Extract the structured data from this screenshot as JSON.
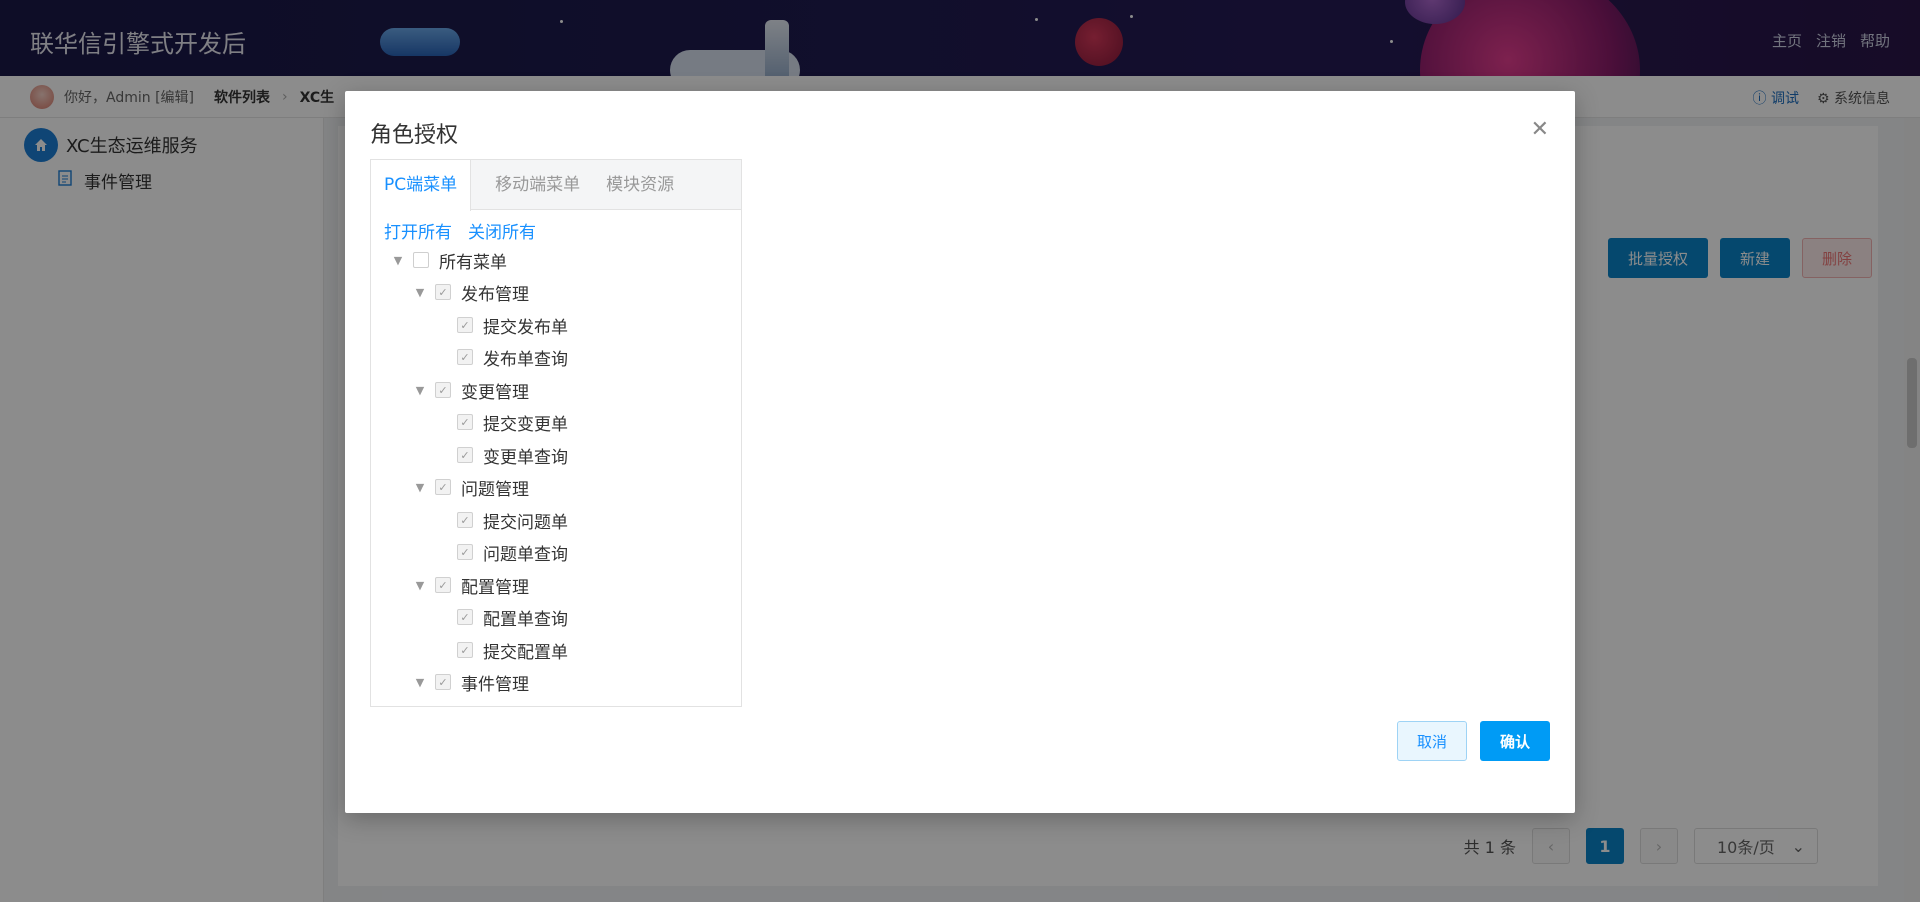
{
  "app": {
    "title": "联华信引擎式开发后",
    "top_links": [
      "主页",
      "注销",
      "帮助"
    ]
  },
  "subbar": {
    "greeting": "你好，Admin [编辑]",
    "breadcrumb": [
      "软件列表",
      "XC生"
    ],
    "right_links": {
      "debug": "调试",
      "sysinfo": "系统信息"
    }
  },
  "sidebar": {
    "root_label": "XC生态运维服务",
    "items": [
      {
        "label": "事件管理"
      }
    ]
  },
  "main": {
    "buttons": {
      "batch": "批量授权",
      "new": "新建",
      "delete": "删除"
    },
    "pagination": {
      "total": "共 1 条",
      "current": "1",
      "page_size": "10条/页"
    }
  },
  "modal": {
    "title": "角色授权",
    "tabs": [
      "PC端菜单",
      "移动端菜单",
      "模块资源"
    ],
    "active_tab": 0,
    "links": {
      "open_all": "打开所有",
      "close_all": "关闭所有"
    },
    "tree": {
      "root": {
        "label": "所有菜单",
        "checked": false
      },
      "groups": [
        {
          "label": "发布管理",
          "children": [
            "提交发布单",
            "发布单查询"
          ]
        },
        {
          "label": "变更管理",
          "children": [
            "提交变更单",
            "变更单查询"
          ]
        },
        {
          "label": "问题管理",
          "children": [
            "提交问题单",
            "问题单查询"
          ]
        },
        {
          "label": "配置管理",
          "children": [
            "配置单查询",
            "提交配置单"
          ]
        },
        {
          "label": "事件管理",
          "children": []
        }
      ]
    },
    "buttons": {
      "cancel": "取消",
      "ok": "确认"
    }
  },
  "colors": {
    "accent": "#1890ff",
    "primary_button": "#009bf5",
    "header_bg": "#1f1c50"
  }
}
